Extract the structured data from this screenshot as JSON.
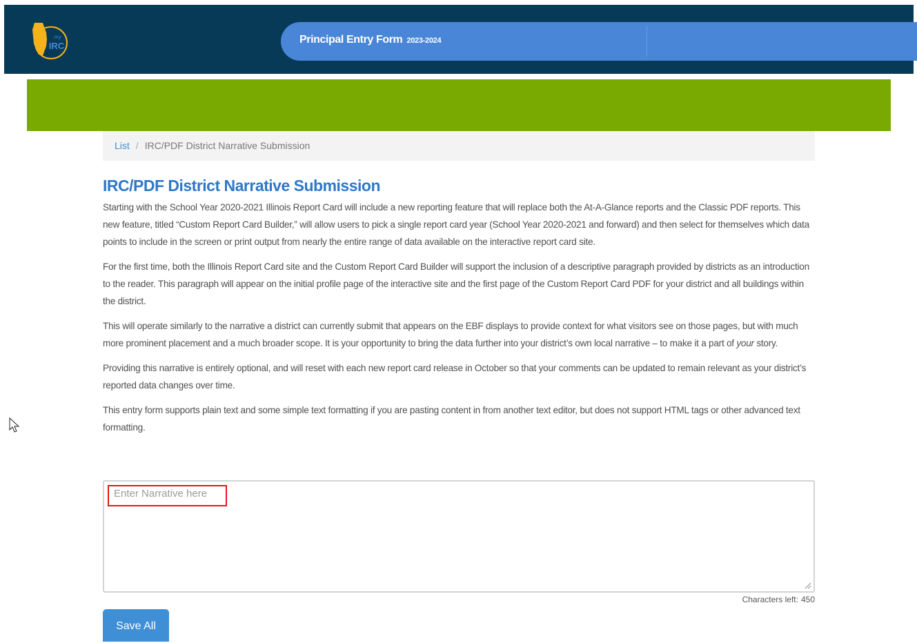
{
  "header": {
    "logo": {
      "icon": "illinois-state-logo-icon",
      "text": "IRC",
      "colors": {
        "state": "#f6b21b",
        "ring": "#f6b21b",
        "text": "#4a86d8"
      }
    },
    "form_title": "Principal Entry Form",
    "form_year": "2023-2024"
  },
  "breadcrumb": {
    "items": [
      {
        "label": "List"
      },
      {
        "label": "IRC/PDF District Narrative Submission"
      }
    ],
    "separator": "/"
  },
  "page": {
    "title": "IRC/PDF District Narrative Submission",
    "paragraphs": [
      "Starting with the School Year 2020-2021 Illinois Report Card will include a new reporting feature that will replace both the At-A-Glance reports and the Classic PDF reports. This new feature, titled “Custom Report Card Builder,” will allow users to pick a single report card year (School Year 2020-2021 and forward) and then select for themselves which data points to include in the screen or print output from nearly the entire range of data available on the interactive report card site.",
      "For the first time, both the Illinois Report Card site and the Custom Report Card Builder will support the inclusion of a descriptive paragraph provided by districts as an introduction to the reader. This paragraph will appear on the initial profile page of the interactive site and the first page of the Custom Report Card PDF for your district and all buildings within the district.",
      {
        "before": "This will operate similarly to the narrative a district can currently submit that appears on the EBF displays to provide context for what visitors see on those pages, but with much more prominent placement and a much broader scope. It is your opportunity to bring the data further into your district’s own local narrative – to make it a part of ",
        "emphasis": "your",
        "after": " story."
      },
      "Providing this narrative is entirely optional, and will reset with each new report card release in October so that your comments can be updated to remain relevant as your district’s reported data changes over time.",
      "This entry form supports plain text and some simple text formatting if you are pasting content in from another text editor, but does not support HTML tags or other advanced text formatting."
    ]
  },
  "narrative_input": {
    "value": "",
    "placeholder": "Enter Narrative here",
    "highlight_color": "#e0151b"
  },
  "characters_left": {
    "label": "Characters left:",
    "value": "450"
  },
  "actions": {
    "save_label": "Save All"
  },
  "colors": {
    "header_bg": "#063a56",
    "title_pill": "#4a86d8",
    "banner_green": "#78aa02",
    "accent_blue": "#2e78c8",
    "button_blue": "#3f8fd6"
  },
  "cursor": {
    "icon": "mouse-pointer-icon"
  }
}
